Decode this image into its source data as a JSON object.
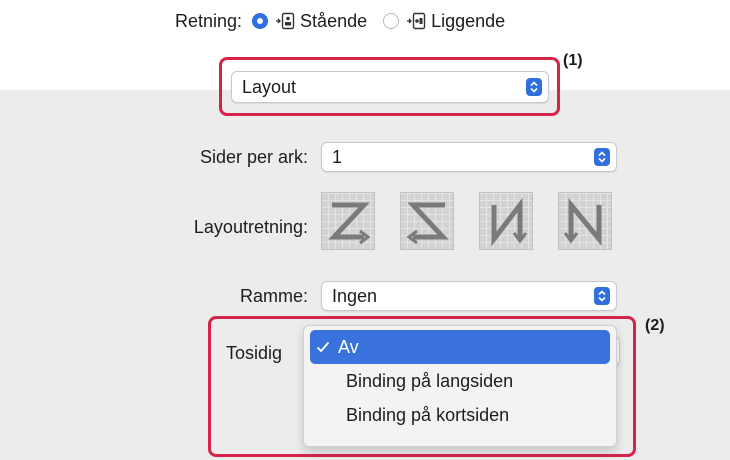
{
  "orientation": {
    "label": "Retning:",
    "portrait_label": "Stående",
    "landscape_label": "Liggende",
    "selected": "portrait"
  },
  "section_popup": {
    "value": "Layout"
  },
  "callouts": {
    "one": "(1)",
    "two": "(2)"
  },
  "pages_per_sheet": {
    "label": "Sider per ark:",
    "value": "1"
  },
  "layout_direction": {
    "label": "Layoutretning:",
    "options": [
      "Z",
      "reverse-Z",
      "N-reverse",
      "N"
    ]
  },
  "border": {
    "label": "Ramme:",
    "value": "Ingen"
  },
  "two_sided": {
    "label": "Tosidig",
    "menu": [
      {
        "label": "Av",
        "selected": true
      },
      {
        "label": "Binding på langsiden",
        "selected": false
      },
      {
        "label": "Binding på kortsiden",
        "selected": false
      }
    ]
  },
  "colors": {
    "accent": "#2f6fe0",
    "highlight": "#d6234a",
    "panel": "#ececec"
  }
}
